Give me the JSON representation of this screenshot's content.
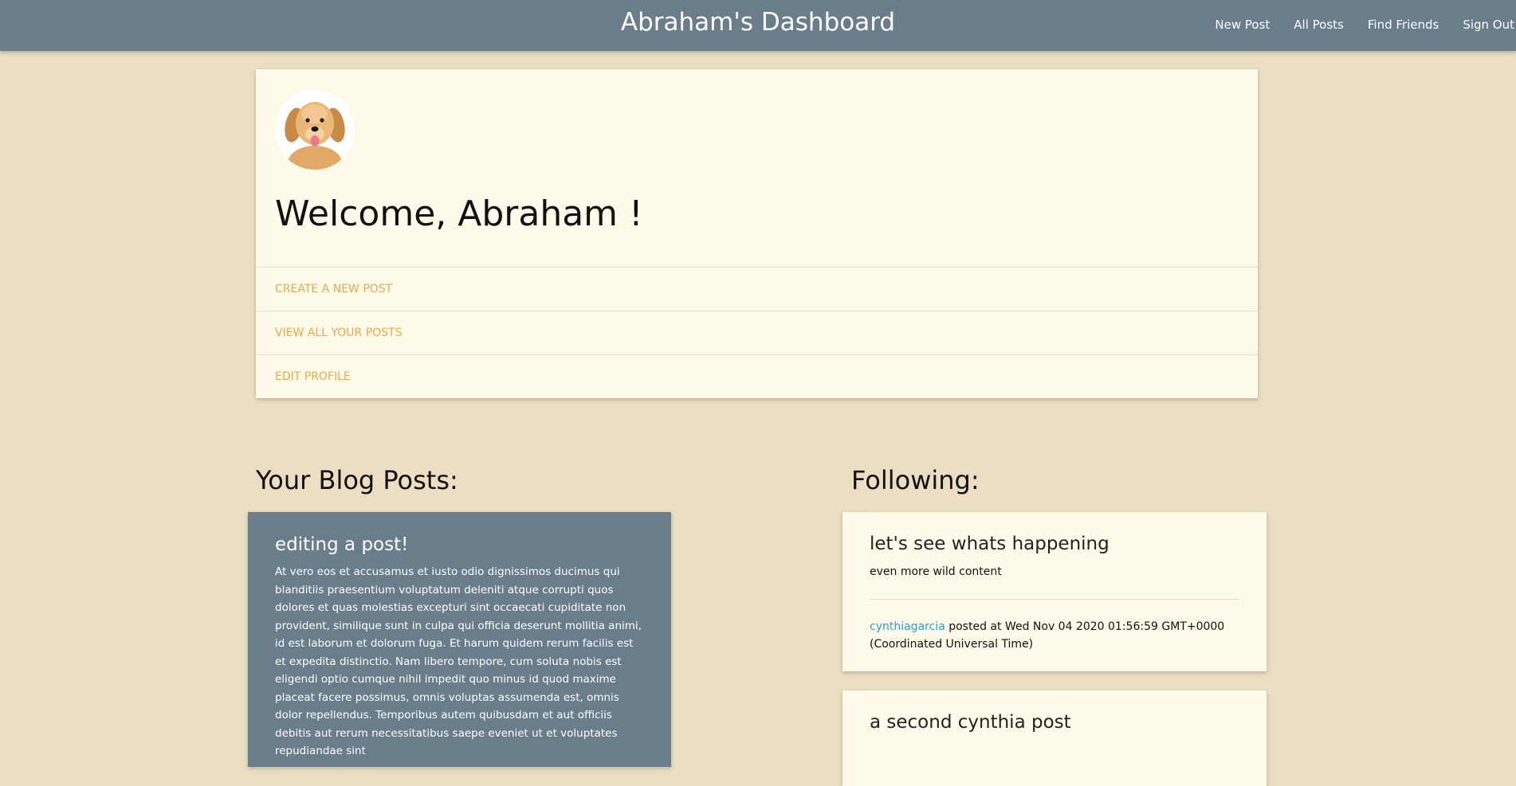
{
  "nav": {
    "brand": "Abraham's Dashboard",
    "links": [
      "New Post",
      "All Posts",
      "Find Friends",
      "Sign Out"
    ]
  },
  "welcome": {
    "title": "Welcome, Abraham !",
    "actions": [
      "CREATE A NEW POST",
      "VIEW ALL YOUR POSTS",
      "EDIT PROFILE"
    ]
  },
  "blog": {
    "heading": "Your Blog Posts:",
    "posts": [
      {
        "title": "editing a post!",
        "body": "At vero eos et accusamus et iusto odio dignissimos ducimus qui blanditiis praesentium voluptatum deleniti atque corrupti quos dolores et quas molestias excepturi sint occaecati cupiditate non provident, similique sunt in culpa qui officia deserunt mollitia animi, id est laborum et dolorum fuga. Et harum quidem rerum facilis est et expedita distinctio. Nam libero tempore, cum soluta nobis est eligendi optio cumque nihil impedit quo minus id quod maxime placeat facere possimus, omnis voluptas assumenda est, omnis dolor repellendus. Temporibus autem quibusdam et aut officiis debitis aut rerum necessitatibus saepe eveniet ut et voluptates repudiandae sint"
      }
    ]
  },
  "following": {
    "heading": "Following:",
    "posts": [
      {
        "title": "let's see whats happening",
        "content": "even more wild content",
        "author": "cynthiagarcia",
        "meta": " posted at Wed Nov 04 2020 01:56:59 GMT+0000 (Coordinated Universal Time)"
      },
      {
        "title": "a second cynthia post"
      }
    ]
  },
  "colors": {
    "background": "#ebdec3",
    "navbar": "#697d8b",
    "card": "#fefaea",
    "accent_link": "#eea84a",
    "author_link": "#2a9fd8"
  }
}
